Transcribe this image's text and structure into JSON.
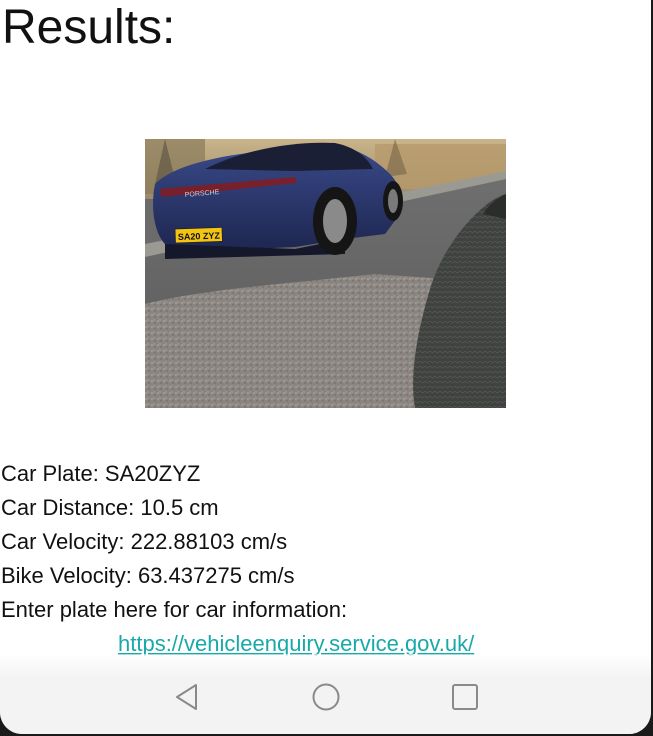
{
  "page": {
    "title": "Results:"
  },
  "result_image": {
    "plate_text": "SA20 ZYZ",
    "brand_text": "PORSCHE"
  },
  "results": {
    "car_plate": "Car Plate: SA20ZYZ",
    "car_distance": "Car Distance: 10.5 cm",
    "car_velocity": "Car Velocity: 222.88103 cm/s",
    "bike_velocity": "Bike Velocity: 63.437275 cm/s",
    "enter_plate_prompt": "Enter plate here for car information:"
  },
  "link": {
    "text": "https://vehicleenquiry.service.gov.uk/"
  },
  "nav": {
    "back_icon": "back-triangle-icon",
    "home_icon": "home-circle-icon",
    "recent_icon": "recent-apps-square-icon"
  },
  "colors": {
    "link": "#1aa9a9",
    "text": "#111111",
    "background": "#ffffff",
    "nav_bar": "#f3f3f3"
  }
}
